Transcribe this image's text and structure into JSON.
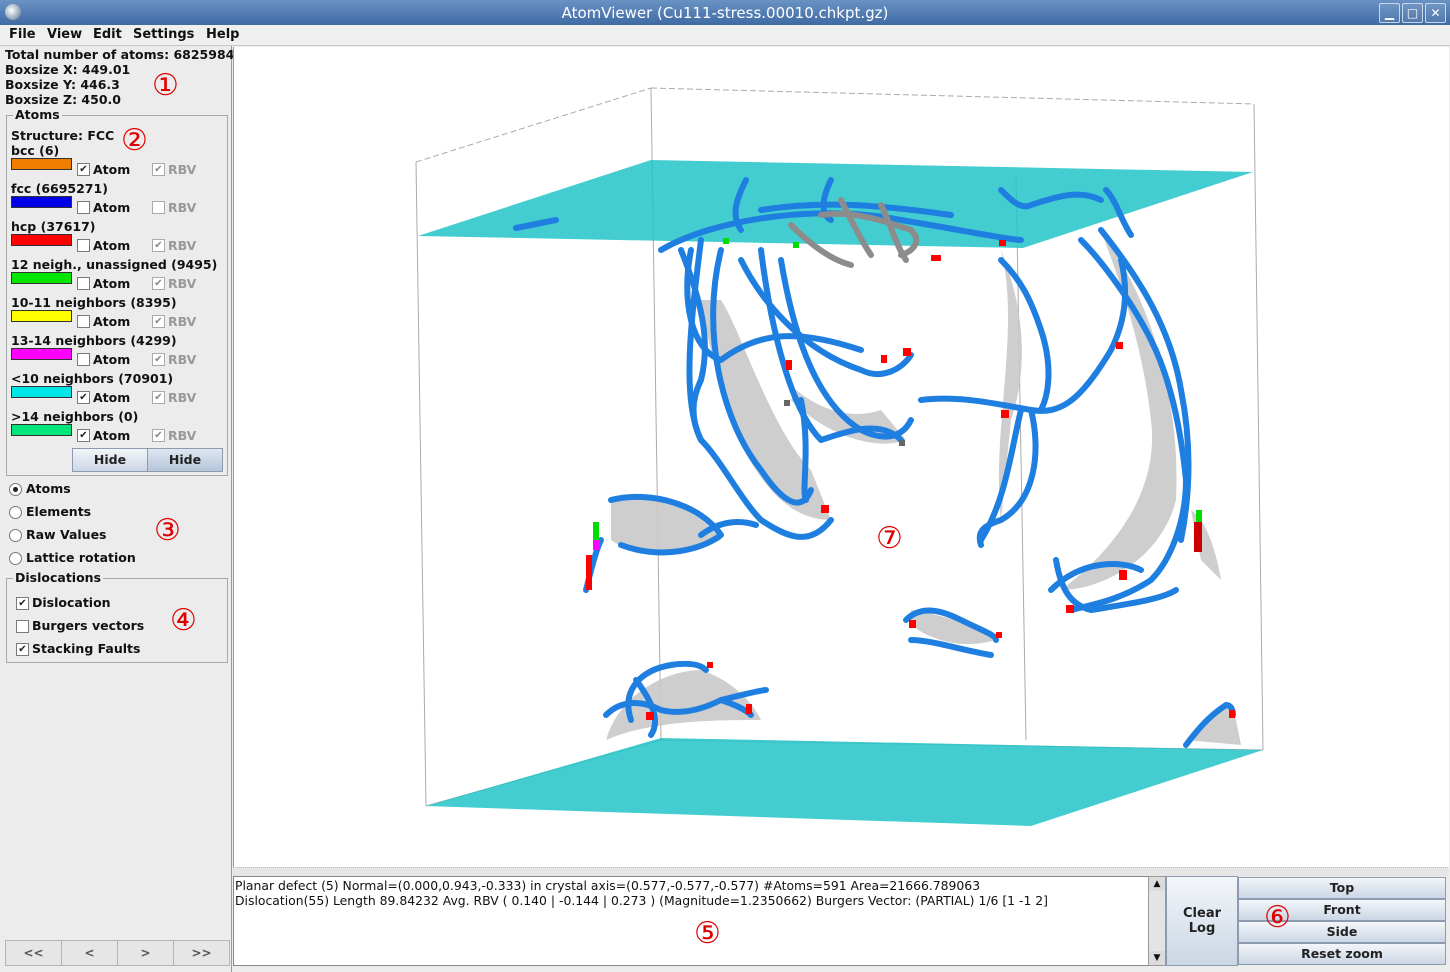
{
  "window": {
    "title": "AtomViewer (Cu111-stress.00010.chkpt.gz)",
    "controls": {
      "minimize": "▁",
      "maximize": "□",
      "close": "✕"
    }
  },
  "menu": [
    "File",
    "View",
    "Edit",
    "Settings",
    "Help"
  ],
  "info": {
    "total_atoms": "Total number of atoms: 6825984",
    "box_x": "Boxsize X: 449.01",
    "box_y": "Boxsize Y: 446.3",
    "box_z": "Boxsize Z: 450.0"
  },
  "atoms_panel": {
    "legend": "Atoms",
    "structure": "Structure: FCC",
    "types": [
      {
        "label": "bcc (6)",
        "color": "#f07c00",
        "atom_checked": true,
        "atom_label": "Atom",
        "rbv_checked": true,
        "rbv_label": "RBV"
      },
      {
        "label": "fcc (6695271)",
        "color": "#0000e6",
        "atom_checked": false,
        "atom_label": "Atom",
        "rbv_checked": false,
        "rbv_label": "RBV"
      },
      {
        "label": "hcp (37617)",
        "color": "#ff0000",
        "atom_checked": false,
        "atom_label": "Atom",
        "rbv_checked": true,
        "rbv_label": "RBV"
      },
      {
        "label": "12 neigh., unassigned (9495)",
        "color": "#00e600",
        "atom_checked": false,
        "atom_label": "Atom",
        "rbv_checked": true,
        "rbv_label": "RBV"
      },
      {
        "label": "10-11 neighbors (8395)",
        "color": "#ffff00",
        "atom_checked": false,
        "atom_label": "Atom",
        "rbv_checked": true,
        "rbv_label": "RBV"
      },
      {
        "label": "13-14 neighbors (4299)",
        "color": "#ff00ff",
        "atom_checked": false,
        "atom_label": "Atom",
        "rbv_checked": true,
        "rbv_label": "RBV"
      },
      {
        "label": "<10 neighbors (70901)",
        "color": "#00e6e6",
        "atom_checked": true,
        "atom_label": "Atom",
        "rbv_checked": true,
        "rbv_label": "RBV"
      },
      {
        "label": ">14 neighbors (0)",
        "color": "#00e67a",
        "atom_checked": true,
        "atom_label": "Atom",
        "rbv_checked": true,
        "rbv_label": "RBV"
      }
    ],
    "hide_atom": "Hide",
    "hide_rbv": "Hide"
  },
  "color_mode": {
    "selected": "Atoms",
    "options": [
      "Atoms",
      "Elements",
      "Raw Values",
      "Lattice rotation"
    ]
  },
  "dislocations": {
    "legend": "Dislocations",
    "items": [
      {
        "label": "Dislocation",
        "checked": true
      },
      {
        "label": "Burgers vectors",
        "checked": false
      },
      {
        "label": "Stacking Faults",
        "checked": true
      }
    ]
  },
  "nav": [
    "<<",
    "<",
    ">",
    ">>"
  ],
  "log": {
    "lines": [
      "Planar defect (5) Normal=(0.000,0.943,-0.333) in crystal axis=(0.577,-0.577,-0.577) #Atoms=591 Area=21666.789063",
      "Dislocation(55) Length 89.84232 Avg. RBV ( 0.140 | -0.144 | 0.273 ) (Magnitude=1.2350662) Burgers Vector: (PARTIAL) 1/6 [1 -1 2]"
    ]
  },
  "clear_log": {
    "line1": "Clear",
    "line2": "Log"
  },
  "view_buttons": [
    "Top",
    "Front",
    "Side",
    "Reset zoom"
  ],
  "annotations": [
    "①",
    "②",
    "③",
    "④",
    "⑤",
    "⑥",
    "⑦"
  ],
  "colors": {
    "dislocation_line": "#1f7fe0",
    "stacking_fault": "#c9c9c9",
    "surface_atoms": "#22c4c8",
    "annotation": "#e00000"
  }
}
